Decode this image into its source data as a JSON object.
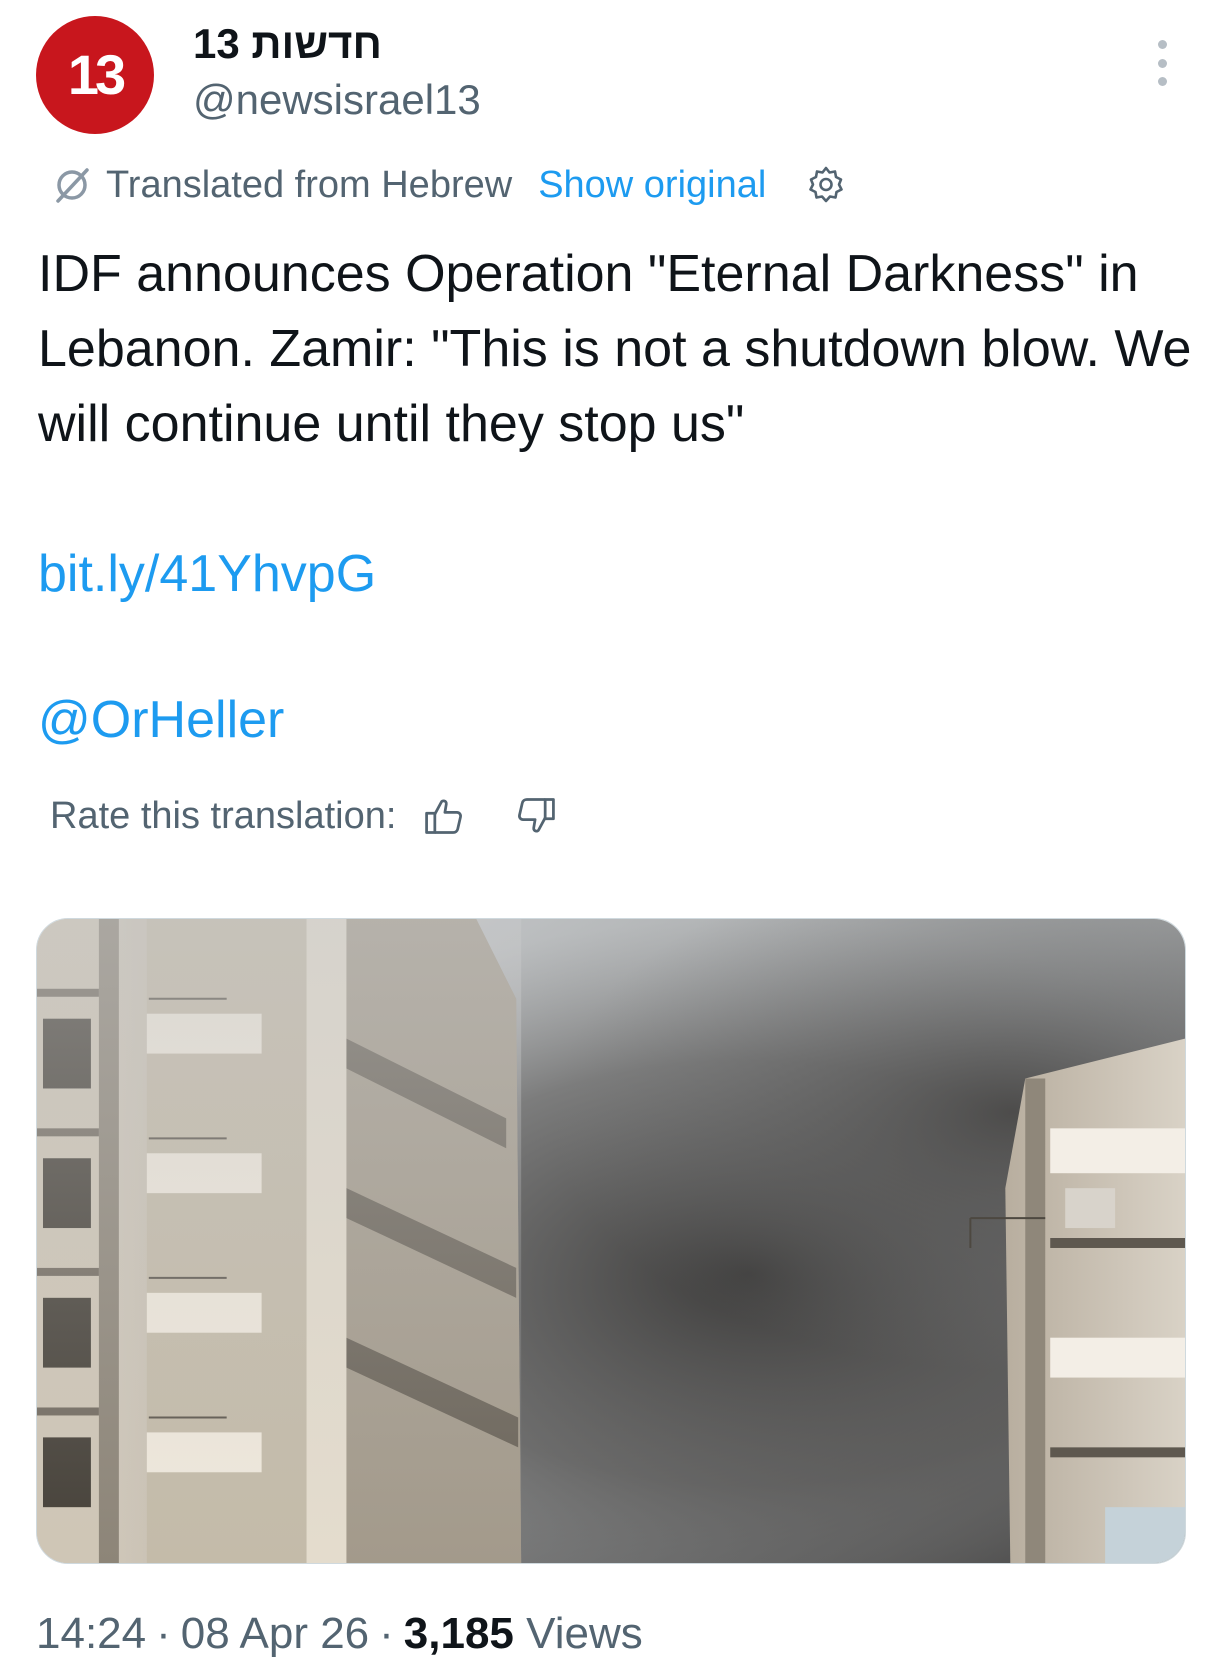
{
  "author": {
    "display_name": "חדשות 13",
    "handle": "@newsisrael13",
    "avatar_text": "13",
    "brand_color": "#c8161d"
  },
  "translation": {
    "status_text": "Translated from Hebrew",
    "show_original_label": "Show original",
    "rate_label": "Rate this translation:"
  },
  "tweet": {
    "text": "IDF announces Operation \"Eternal Darkness\" in Lebanon. Zamir: \"This is not a shutdown blow. We will continue until they stop us\"",
    "link": "bit.ly/41YhvpG",
    "mention": "@OrHeller"
  },
  "meta": {
    "time": "14:24",
    "date": "08 Apr 26",
    "separator": "·",
    "views_count": "3,185",
    "views_label": "Views"
  },
  "colors": {
    "link": "#1d9bf0",
    "secondary_text": "#536471",
    "primary_text": "#0f1419"
  },
  "icons": {
    "more": "more-icon",
    "translate": "translate-icon",
    "settings": "gear-icon",
    "thumbs_up": "thumbs-up-icon",
    "thumbs_down": "thumbs-down-icon"
  }
}
